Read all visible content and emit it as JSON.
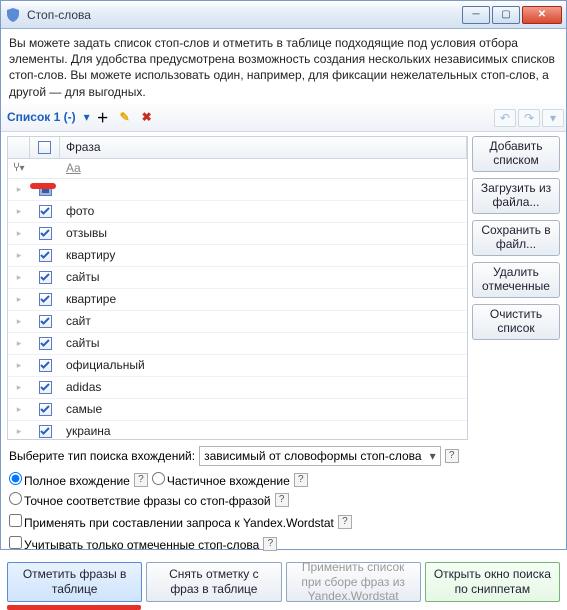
{
  "window": {
    "title": "Стоп-слова"
  },
  "description": "Вы можете задать список стоп-слов и отметить в таблице подходящие под условия отбора элементы. Для удобства предусмотрена возможность создания нескольких независимых списков стоп-слов. Вы можете использовать один, например, для фиксации нежелательных стоп-слов, а другой — для выгодных.",
  "toolbar": {
    "list_label": "Список 1 (-)"
  },
  "grid": {
    "header": {
      "phrase": "Фраза"
    },
    "filter_hint": "Aa",
    "rows": [
      {
        "checked": "ind",
        "text": ""
      },
      {
        "checked": true,
        "text": "фото"
      },
      {
        "checked": true,
        "text": "отзывы"
      },
      {
        "checked": true,
        "text": "квартиру"
      },
      {
        "checked": true,
        "text": "сайты"
      },
      {
        "checked": true,
        "text": "квартире"
      },
      {
        "checked": true,
        "text": "сайт"
      },
      {
        "checked": true,
        "text": "сайты"
      },
      {
        "checked": true,
        "text": "официальный"
      },
      {
        "checked": true,
        "text": "adidas"
      },
      {
        "checked": true,
        "text": "самые"
      },
      {
        "checked": true,
        "text": "украина"
      }
    ]
  },
  "side_buttons": {
    "add": "Добавить списком",
    "load": "Загрузить из файла...",
    "save": "Сохранить в файл...",
    "delete": "Удалить отмеченные",
    "clear": "Очистить список"
  },
  "options": {
    "search_type_label": "Выберите тип поиска вхождений:",
    "search_type_value": "зависимый от словоформы стоп-слова",
    "full": "Полное вхождение",
    "partial": "Частичное вхождение",
    "exact": "Точное соответствие фразы со стоп-фразой",
    "wordstat": "Применять при составлении запроса к Yandex.Wordstat",
    "only_checked": "Учитывать только отмеченные стоп-слова"
  },
  "bottom": {
    "mark": "Отметить фразы в таблице",
    "unmark": "Снять отметку с фраз в таблице",
    "apply": "Применить список при сборе фраз из Yandex.Wordstat",
    "snippets": "Открыть окно поиска по сниппетам"
  }
}
